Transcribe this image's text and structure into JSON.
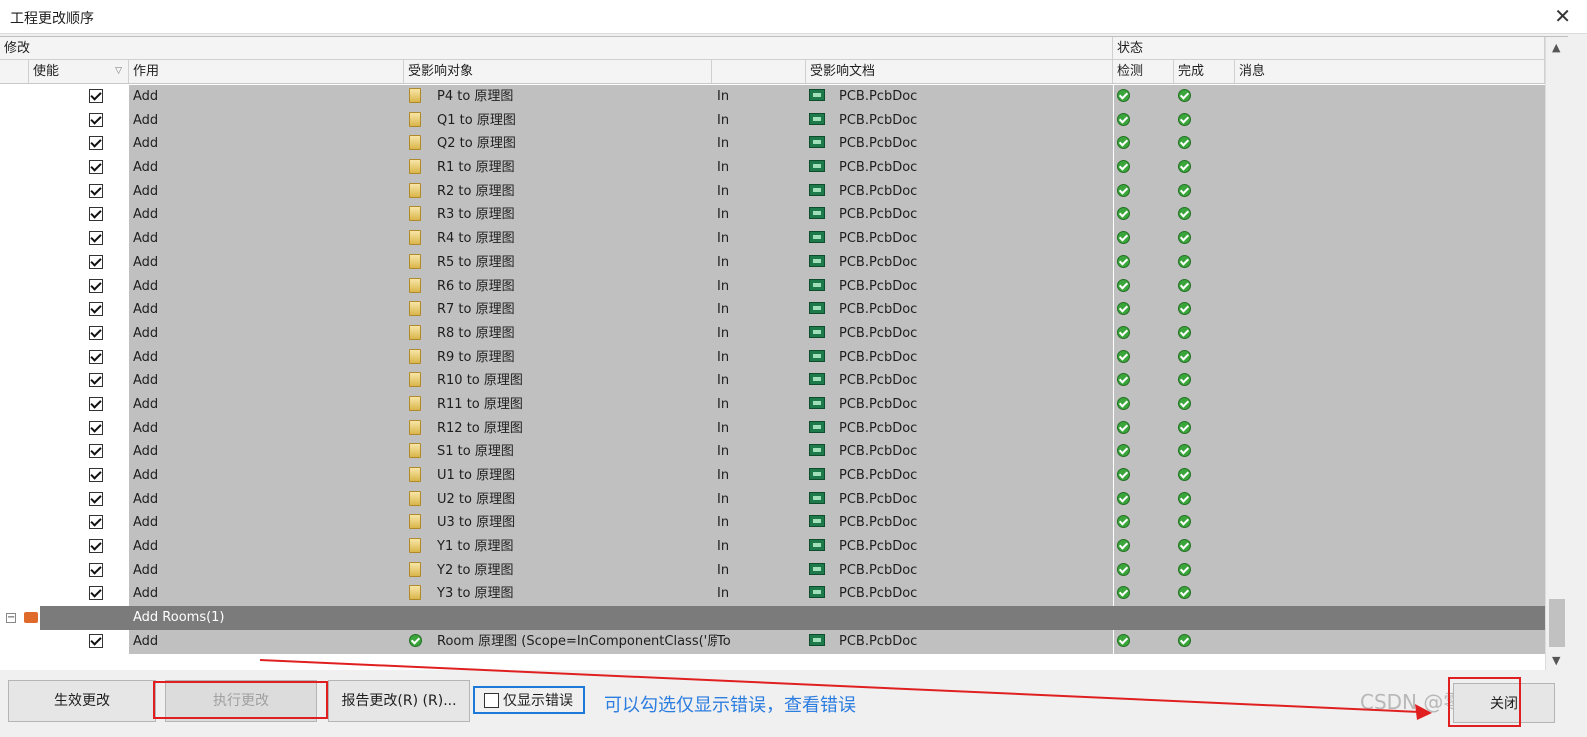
{
  "window": {
    "title": "工程更改顺序",
    "close_glyph": "✕"
  },
  "header": {
    "group_modify": "修改",
    "group_status": "状态",
    "col_enable": "使能",
    "col_action": "作用",
    "col_object": "受影响对象",
    "col_doc": "受影响文档",
    "col_check": "检测",
    "col_done": "完成",
    "col_msg": "消息"
  },
  "rows": [
    {
      "action": "Add",
      "object": "P4 to 原理图",
      "dir": "In",
      "doc": "PCB.PcbDoc"
    },
    {
      "action": "Add",
      "object": "Q1 to 原理图",
      "dir": "In",
      "doc": "PCB.PcbDoc"
    },
    {
      "action": "Add",
      "object": "Q2 to 原理图",
      "dir": "In",
      "doc": "PCB.PcbDoc"
    },
    {
      "action": "Add",
      "object": "R1 to 原理图",
      "dir": "In",
      "doc": "PCB.PcbDoc"
    },
    {
      "action": "Add",
      "object": "R2 to 原理图",
      "dir": "In",
      "doc": "PCB.PcbDoc"
    },
    {
      "action": "Add",
      "object": "R3 to 原理图",
      "dir": "In",
      "doc": "PCB.PcbDoc"
    },
    {
      "action": "Add",
      "object": "R4 to 原理图",
      "dir": "In",
      "doc": "PCB.PcbDoc"
    },
    {
      "action": "Add",
      "object": "R5 to 原理图",
      "dir": "In",
      "doc": "PCB.PcbDoc"
    },
    {
      "action": "Add",
      "object": "R6 to 原理图",
      "dir": "In",
      "doc": "PCB.PcbDoc"
    },
    {
      "action": "Add",
      "object": "R7 to 原理图",
      "dir": "In",
      "doc": "PCB.PcbDoc"
    },
    {
      "action": "Add",
      "object": "R8 to 原理图",
      "dir": "In",
      "doc": "PCB.PcbDoc"
    },
    {
      "action": "Add",
      "object": "R9 to 原理图",
      "dir": "In",
      "doc": "PCB.PcbDoc"
    },
    {
      "action": "Add",
      "object": "R10 to 原理图",
      "dir": "In",
      "doc": "PCB.PcbDoc"
    },
    {
      "action": "Add",
      "object": "R11 to 原理图",
      "dir": "In",
      "doc": "PCB.PcbDoc"
    },
    {
      "action": "Add",
      "object": "R12 to 原理图",
      "dir": "In",
      "doc": "PCB.PcbDoc"
    },
    {
      "action": "Add",
      "object": "S1 to 原理图",
      "dir": "In",
      "doc": "PCB.PcbDoc"
    },
    {
      "action": "Add",
      "object": "U1 to 原理图",
      "dir": "In",
      "doc": "PCB.PcbDoc"
    },
    {
      "action": "Add",
      "object": "U2 to 原理图",
      "dir": "In",
      "doc": "PCB.PcbDoc"
    },
    {
      "action": "Add",
      "object": "U3 to 原理图",
      "dir": "In",
      "doc": "PCB.PcbDoc"
    },
    {
      "action": "Add",
      "object": "Y1 to 原理图",
      "dir": "In",
      "doc": "PCB.PcbDoc"
    },
    {
      "action": "Add",
      "object": "Y2 to 原理图",
      "dir": "In",
      "doc": "PCB.PcbDoc"
    },
    {
      "action": "Add",
      "object": "Y3 to 原理图",
      "dir": "In",
      "doc": "PCB.PcbDoc"
    }
  ],
  "group": {
    "label": "Add Rooms(1)",
    "collapse_glyph": "−"
  },
  "room_row": {
    "action": "Add",
    "object": "Room 原理图 (Scope=InComponentClass('原理",
    "dir": "To",
    "doc": "PCB.PcbDoc"
  },
  "buttons": {
    "validate": "生效更改",
    "execute": "执行更改",
    "report": "报告更改(R) (R)...",
    "only_errors": "仅显示错误",
    "close": "关闭"
  },
  "annotation": "可以勾选仅显示错误，查看错误",
  "watermark": "CSDN @零度cc",
  "colors": {
    "annotation_blue": "#2b7de0",
    "highlight_red": "#e02020",
    "row_gray": "#c0c0c0",
    "group_gray": "#7b7b7b",
    "ok_green": "#3aa53a"
  },
  "icons": {
    "component": "component-icon",
    "pcb_doc": "pcb-document-icon",
    "status_ok": "check-ok-icon",
    "folder": "folder-icon"
  }
}
